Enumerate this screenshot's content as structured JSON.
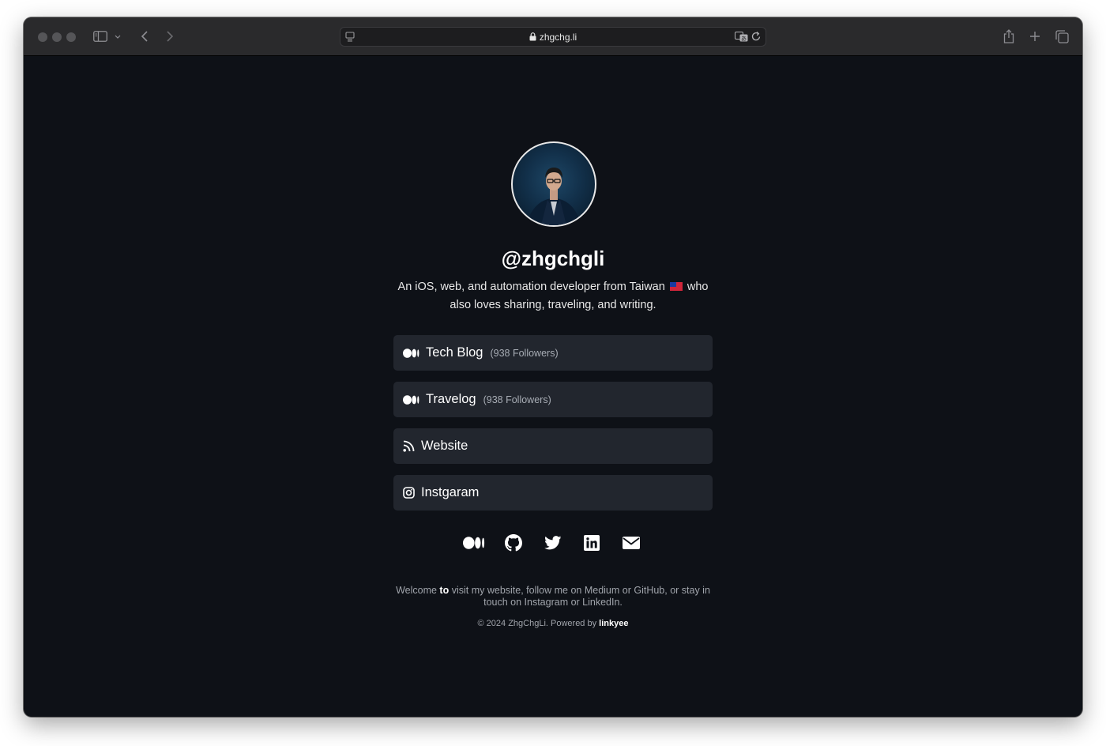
{
  "browser": {
    "url": "zhgchg.li"
  },
  "profile": {
    "handle": "@zhgchgli",
    "bio_part1": "An iOS, web, and automation developer from Taiwan",
    "bio_part2": "who also loves sharing, traveling, and writing."
  },
  "links": [
    {
      "label": "Tech Blog",
      "followers": "(938 Followers)",
      "icon": "medium-icon"
    },
    {
      "label": "Travelog",
      "followers": "(938 Followers)",
      "icon": "medium-icon"
    },
    {
      "label": "Website",
      "followers": "",
      "icon": "rss-icon"
    },
    {
      "label": "Instgaram",
      "followers": "",
      "icon": "instagram-icon"
    }
  ],
  "social_icons": [
    "medium-icon",
    "github-icon",
    "twitter-icon",
    "linkedin-icon",
    "email-icon"
  ],
  "footer": {
    "welcome_part1": "Welcome",
    "welcome_bold": "to",
    "welcome_part2": "visit my website, follow me on Medium or GitHub, or stay in touch on Instagram or LinkedIn.",
    "copyright": "© 2024 ZhgChgLi. Powered by",
    "powered_by": "linkyee"
  },
  "colors": {
    "page_bg": "#0e1117",
    "button_bg": "#22262e",
    "toolbar_bg": "#2a2a2c"
  }
}
